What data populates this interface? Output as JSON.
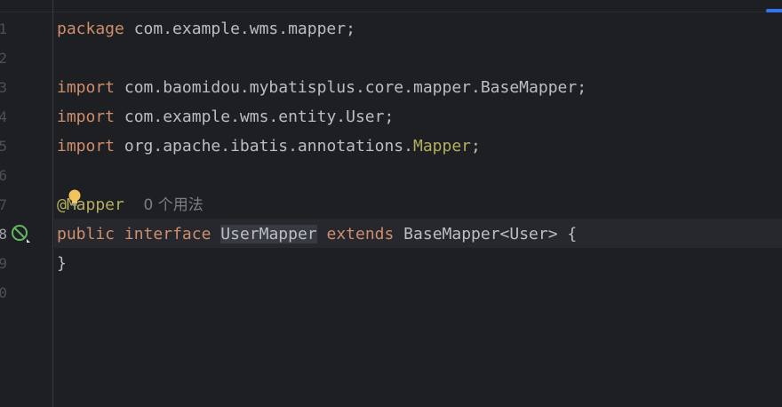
{
  "editor": {
    "line_numbers": [
      "1",
      "2",
      "3",
      "4",
      "5",
      "6",
      "7",
      "8",
      "9",
      "0"
    ],
    "current_line": "8",
    "lines": {
      "l1": {
        "keyword": "package",
        "rest": " com.example.wms.mapper;"
      },
      "l3": {
        "keyword": "import",
        "rest": " com.baomidou.mybatisplus.core.mapper.BaseMapper;"
      },
      "l4": {
        "keyword": "import",
        "rest": " com.example.wms.entity.User;"
      },
      "l5": {
        "keyword": "import",
        "rest": " org.apache.ibatis.annotations.",
        "annotation": "Mapper",
        "tail": ";"
      },
      "l7": {
        "annotation": "@Mapper",
        "hint": "0 个用法"
      },
      "l8": {
        "kw_public": "public",
        "kw_interface": "interface",
        "class_name": "UserMapper",
        "kw_extends": "extends",
        "rest": " BaseMapper<User> {"
      },
      "l9": {
        "rest": "}"
      }
    },
    "icons": {
      "gutter": "implemented-by-icon",
      "intention": "lightbulb-icon"
    },
    "colors": {
      "background": "#1e1f22",
      "keyword": "#cf8e6d",
      "annotation": "#b3ae60",
      "text": "#bcbec4",
      "hint": "#7a7e85",
      "accent": "#3574f0"
    }
  }
}
